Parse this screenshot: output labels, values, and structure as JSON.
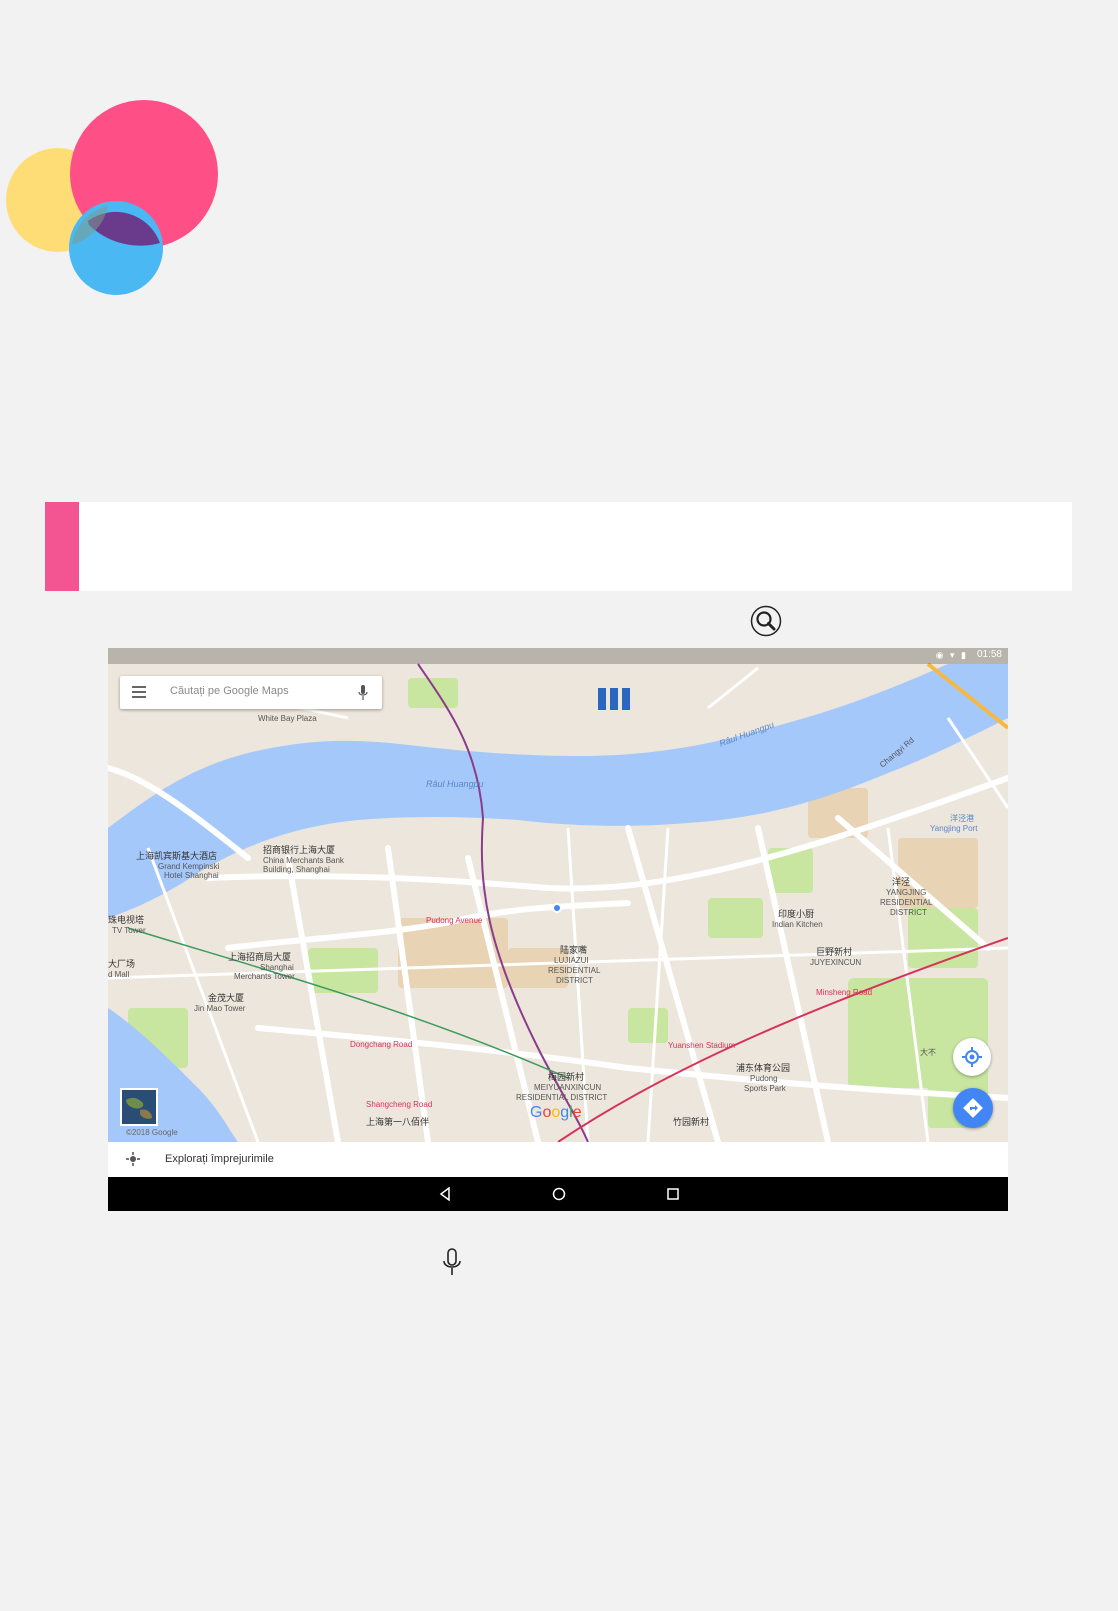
{
  "colors": {
    "accent_pink": "#f25591",
    "logo_pink": "#ff4f87",
    "logo_yellow": "#ffdd76",
    "logo_blue": "#4ab8f2",
    "logo_overlap": "#6a3a8c",
    "water": "#a5c8fa",
    "park": "#c8e6a0",
    "road": "#ffffff",
    "fab_blue": "#4285f4"
  },
  "icons": {
    "page_search": "search-icon",
    "page_mic": "microphone-icon",
    "menu": "hamburger-menu-icon",
    "search_mic": "microphone-icon",
    "my_location": "my-location-icon",
    "directions": "directions-icon",
    "explore": "explore-icon",
    "back": "nav-back-icon",
    "home": "nav-home-icon",
    "recent": "nav-recent-icon"
  },
  "status_bar": {
    "time": "01:58"
  },
  "search": {
    "placeholder": "Căutați pe Google Maps"
  },
  "map": {
    "google_logo": "Google",
    "copyright": "©2018 Google",
    "labels": {
      "river1": "Râul Huangpu",
      "river2": "Râul Huangpu",
      "changyi": "Changyi Rd",
      "cmb_cn": "招商银行上海大厦",
      "cmb_en1": "China Merchants Bank",
      "cmb_en2": "Building, Shanghai",
      "kempinski_cn": "上海凯宾斯基大酒店",
      "kempinski_en1": "Grand Kempinski",
      "kempinski_en2": "Hotel Shanghai",
      "tv_cn": "珠电视塔",
      "tv_en": "TV Tower",
      "ifc_cn": "大厂场",
      "ifc_en": "d Mall",
      "merchants_cn": "上海招商局大厦",
      "merchants_en1": "Shanghai",
      "merchants_en2": "Merchants Tower",
      "jinmao_cn": "金茂大厦",
      "jinmao_en": "Jin Mao Tower",
      "lujiazui_cn": "陆家嘴",
      "lujiazui_en1": "LUJIAZUI",
      "lujiazui_en2": "RESIDENTIAL",
      "lujiazui_en3": "DISTRICT",
      "yangjing_cn": "洋泾",
      "yangjing_en1": "YANGJING",
      "yangjing_en2": "RESIDENTIAL",
      "yangjing_en3": "DISTRICT",
      "indian_cn": "印度小厨",
      "indian_en": "Indian Kitchen",
      "juyexincun_cn": "巨野新村",
      "juyexincun_en": "JUYEXINCUN",
      "yangjingport_cn": "洋泾港",
      "yangjingport_en": "Yangjing Port",
      "meiyuan_cn": "梅园新村",
      "meiyuan_en1": "MEIYUANXINCUN",
      "meiyuan_en2": "RESIDENTIAL DISTRICT",
      "sports_cn": "浦东体育公园",
      "sports_en1": "Pudong",
      "sports_en2": "Sports Park",
      "pudong_ave": "Pudong Avenue",
      "dongchang": "Dongchang Road",
      "shangcheng": "Shangcheng Road",
      "shanghai_no1": "上海第一八佰伴",
      "white_bay": "White Bay Plaza",
      "zhuyuan": "竹园新村",
      "daduhe": "大不",
      "yuanshen": "Yuanshen Stadium",
      "minsheng": "Minsheng Road"
    }
  },
  "bottom_sheet": {
    "label": "Explorați împrejurimile"
  }
}
